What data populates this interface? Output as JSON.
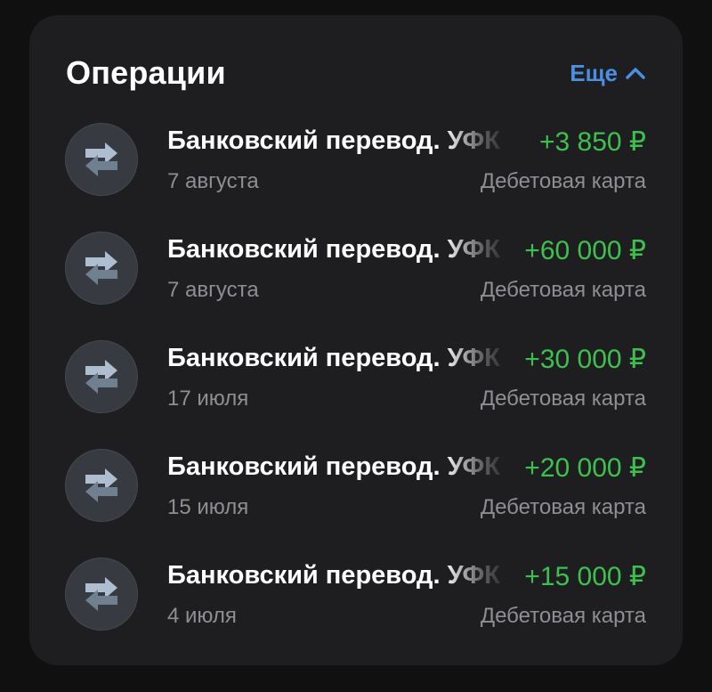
{
  "header": {
    "title": "Операции",
    "more_label": "Еще",
    "more_icon": "chevron-up-icon",
    "accent_color": "#4b8fe0"
  },
  "operations": [
    {
      "icon": "transfer-arrows-icon",
      "name": "Банковский перевод. УФК",
      "amount": "+3 850 ₽",
      "date": "7 августа",
      "account": "Дебетовая карта"
    },
    {
      "icon": "transfer-arrows-icon",
      "name": "Банковский перевод. УФК",
      "amount": "+60 000 ₽",
      "date": "7 августа",
      "account": "Дебетовая карта"
    },
    {
      "icon": "transfer-arrows-icon",
      "name": "Банковский перевод. УФК",
      "amount": "+30 000 ₽",
      "date": "17 июля",
      "account": "Дебетовая карта"
    },
    {
      "icon": "transfer-arrows-icon",
      "name": "Банковский перевод. УФК",
      "amount": "+20 000 ₽",
      "date": "15 июля",
      "account": "Дебетовая карта"
    },
    {
      "icon": "transfer-arrows-icon",
      "name": "Банковский перевод. УФК",
      "amount": "+15 000 ₽",
      "date": "4 июля",
      "account": "Дебетовая карта"
    }
  ],
  "colors": {
    "income_amount": "#3cc14e",
    "card_background": "#1e1e21",
    "secondary_text": "#8e8e93"
  }
}
